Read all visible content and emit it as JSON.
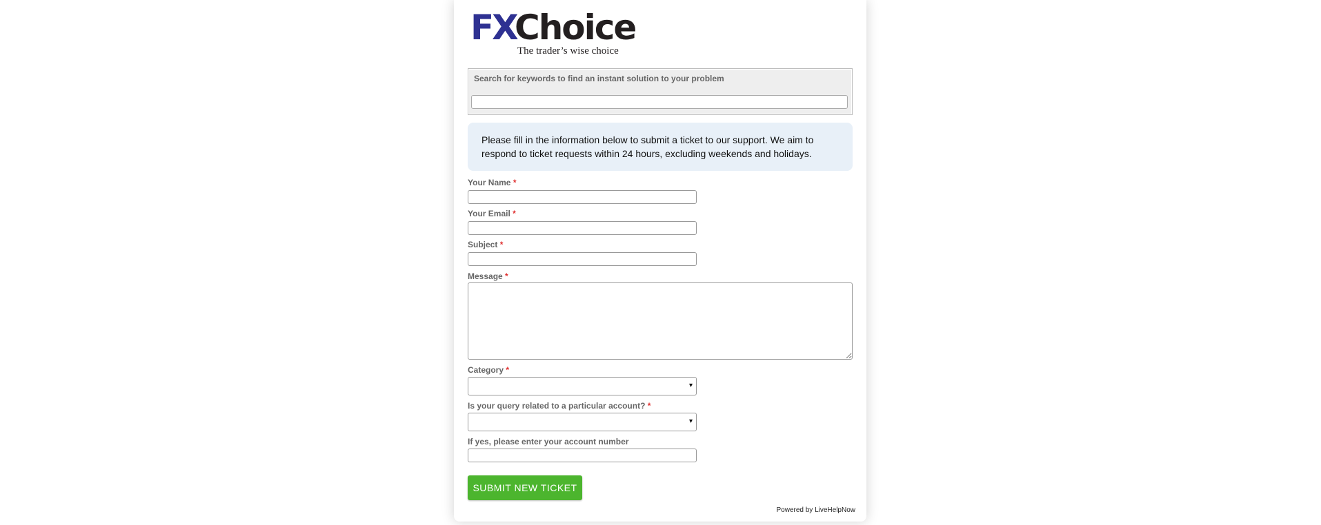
{
  "logo": {
    "brand_fx": "FX",
    "brand_choice": "Choice",
    "tagline": "The trader’s wise choice",
    "colors": {
      "fx": "#2e3192",
      "choice": "#231f20"
    }
  },
  "search": {
    "label": "Search for keywords to find an instant solution to your problem",
    "value": "",
    "placeholder": ""
  },
  "notice": {
    "text": "Please fill in the information below to submit a ticket to our support. We aim to respond to ticket requests within 24 hours, excluding weekends and holidays."
  },
  "form": {
    "required_marker": "*",
    "name": {
      "label": "Your Name",
      "value": ""
    },
    "email": {
      "label": "Your Email",
      "value": ""
    },
    "subject": {
      "label": "Subject",
      "value": ""
    },
    "message": {
      "label": "Message",
      "value": ""
    },
    "category": {
      "label": "Category",
      "selected": "",
      "arrow": "▾"
    },
    "account_related": {
      "label": "Is your query related to a particular account?",
      "selected": "",
      "arrow": "▾"
    },
    "account_number": {
      "label": "If yes, please enter your account number",
      "value": ""
    },
    "submit_label": "SUBMIT NEW TICKET",
    "submit_color": "#4cb52e"
  },
  "footer": {
    "powered_by": "Powered by LiveHelpNow"
  }
}
